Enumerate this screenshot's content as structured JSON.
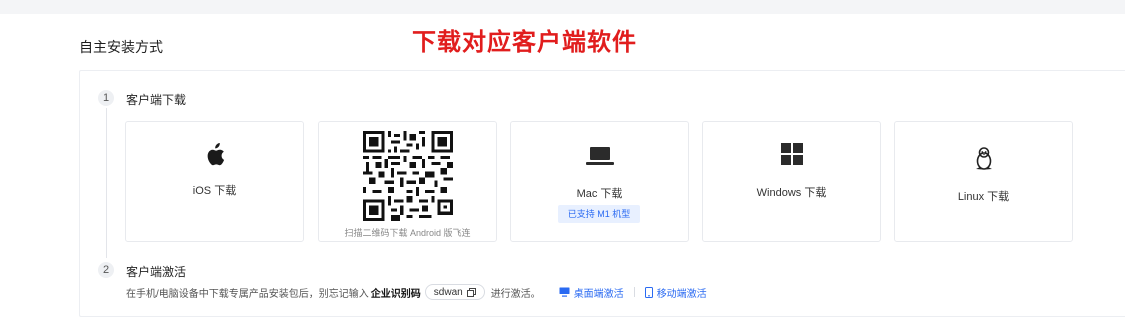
{
  "page": {
    "section_title": "自主安装方式",
    "annotation": "下载对应客户端软件"
  },
  "steps": [
    {
      "number": "1",
      "title": "客户端下载"
    },
    {
      "number": "2",
      "title": "客户端激活"
    }
  ],
  "downloads": {
    "ios": {
      "label": "iOS 下载",
      "icon": "apple-icon"
    },
    "android": {
      "caption": "扫描二维码下载 Android 版飞连",
      "icon": "qr-code-icon"
    },
    "mac": {
      "label": "Mac 下载",
      "tag": "已支持 M1 机型",
      "icon": "laptop-icon"
    },
    "windows": {
      "label": "Windows 下载",
      "icon": "windows-icon"
    },
    "linux": {
      "label": "Linux 下载",
      "icon": "linux-penguin-icon"
    }
  },
  "activation": {
    "prefix": "在手机/电脑设备中下载专属产品安装包后，别忘记输入",
    "code_label": "企业识别码",
    "code_value": "sdwan",
    "suffix": "进行激活。",
    "desktop_link": "桌面端激活",
    "mobile_link": "移动端激活"
  },
  "colors": {
    "accent": "#2a6af2",
    "annotation": "#e11d1d"
  }
}
